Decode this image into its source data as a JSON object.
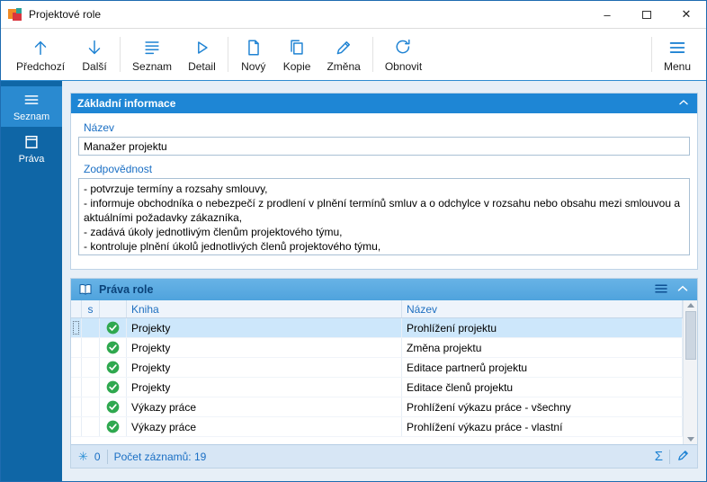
{
  "window": {
    "title": "Projektové role"
  },
  "icons": {
    "minimize": "–",
    "close": "✕",
    "sum": "Σ",
    "flag": "✳"
  },
  "toolbar": {
    "buttons": [
      {
        "label": "Předchozí",
        "icon": "arrow-up-icon"
      },
      {
        "label": "Další",
        "icon": "arrow-down-icon"
      },
      {
        "label": "Seznam",
        "icon": "list-icon"
      },
      {
        "label": "Detail",
        "icon": "play-outline-icon"
      },
      {
        "label": "Nový",
        "icon": "new-document-icon"
      },
      {
        "label": "Kopie",
        "icon": "copy-icon"
      },
      {
        "label": "Změna",
        "icon": "pencil-icon"
      },
      {
        "label": "Obnovit",
        "icon": "refresh-icon"
      }
    ],
    "menu_label": "Menu"
  },
  "sidebar": {
    "items": [
      {
        "label": "Seznam",
        "icon": "list-icon",
        "active": true
      },
      {
        "label": "Práva",
        "icon": "card-icon",
        "active": false
      }
    ]
  },
  "basic_info": {
    "header": "Základní informace",
    "name_label": "Název",
    "name_value": "Manažer projektu",
    "responsibility_label": "Zodpovědnost",
    "responsibility_value": "- potvrzuje termíny a rozsahy smlouvy,\n- informuje obchodníka o nebezpečí z prodlení v plnění termínů smluv a o odchylce v rozsahu nebo obsahu mezi smlouvou a aktuálními požadavky zákazníka,\n- zadává úkoly jednotlivým členům projektového týmu,\n- kontroluje plnění úkolů jednotlivých členů projektového týmu,"
  },
  "rights": {
    "header": "Práva role",
    "columns": [
      "s",
      "Kniha",
      "Název"
    ],
    "rows": [
      {
        "kniha": "Projekty",
        "nazev": "Prohlížení projektu"
      },
      {
        "kniha": "Projekty",
        "nazev": "Změna projektu"
      },
      {
        "kniha": "Projekty",
        "nazev": "Editace partnerů projektu"
      },
      {
        "kniha": "Projekty",
        "nazev": "Editace členů projektu"
      },
      {
        "kniha": "Výkazy práce",
        "nazev": "Prohlížení výkazu práce - všechny"
      },
      {
        "kniha": "Výkazy práce",
        "nazev": "Prohlížení výkazu práce - vlastní"
      }
    ],
    "footer": {
      "flag_count": "0",
      "record_count_label": "Počet záznamů: 19"
    }
  },
  "colors": {
    "accent_blue": "#1e86d5",
    "sidebar_blue": "#0f66a6",
    "selection_blue": "#cde7fb",
    "check_green": "#2fa84f",
    "icon_blue": "#1f83d3"
  }
}
